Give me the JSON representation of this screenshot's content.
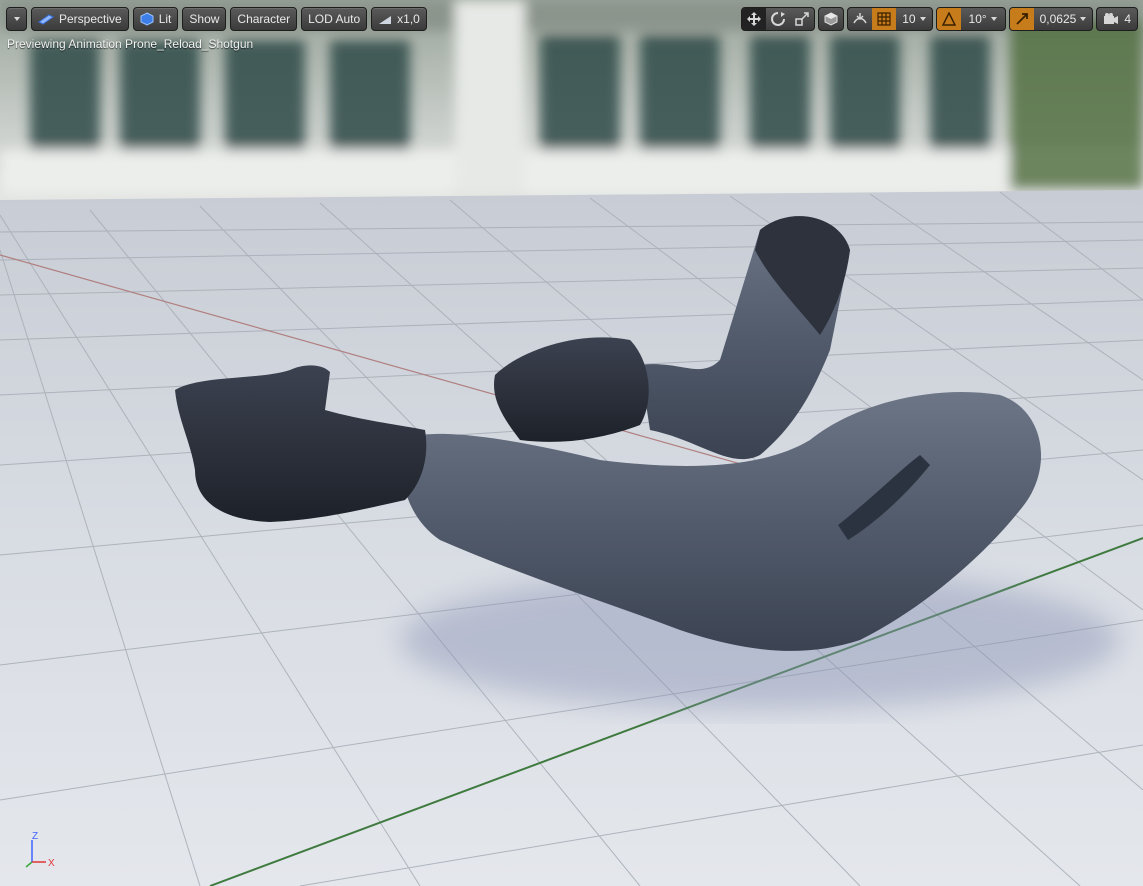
{
  "toolbar": {
    "view_menu_label": "",
    "perspective_label": "Perspective",
    "lit_label": "Lit",
    "show_label": "Show",
    "character_label": "Character",
    "lod_label": "LOD Auto",
    "speed_label": "x1,0",
    "grid_snap_value": "10",
    "rotation_snap_value": "10°",
    "scale_snap_value": "0,0625",
    "camera_speed_value": "4"
  },
  "viewport": {
    "preview_text": "Previewing Animation Prone_Reload_Shotgun",
    "axis_z": "Z",
    "axis_x": "X"
  },
  "icons": [
    "dropdown-caret-icon",
    "perspective-icon",
    "lit-sphere-icon",
    "speed-icon",
    "translate-icon",
    "rotate-icon",
    "scale-icon",
    "world-local-icon",
    "surface-snap-icon",
    "grid-snap-icon",
    "rotation-snap-icon",
    "scale-snap-icon",
    "camera-speed-icon"
  ],
  "colors": {
    "accent_active": "#c77c1b",
    "toolbar_bg": "#4a4a4a",
    "floor": "#dfe3ea"
  }
}
